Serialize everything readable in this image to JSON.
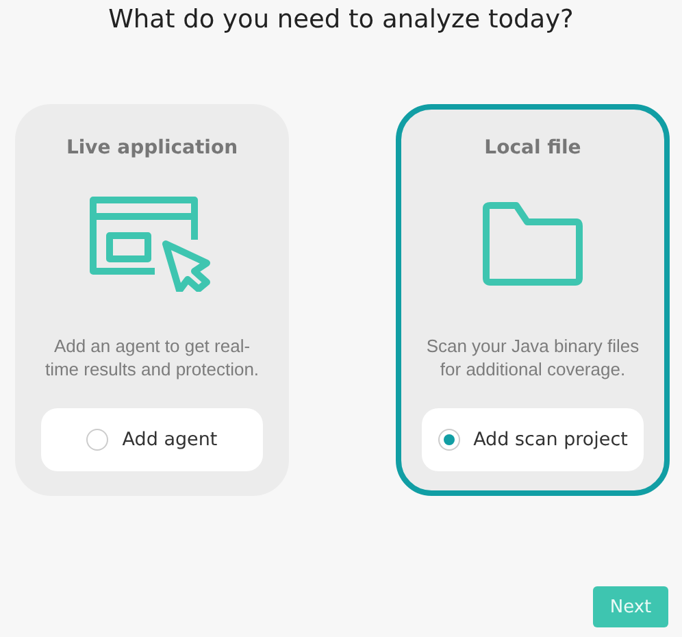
{
  "heading": "What do you need to analyze today?",
  "options": [
    {
      "title": "Live application",
      "kind": "window",
      "description": "Add an agent to get real-time results and protection.",
      "button": "Add agent",
      "selected": false
    },
    {
      "title": "Local file",
      "kind": "folder",
      "description": "Scan your Java binary files for additional coverage.",
      "button": "Add scan project",
      "selected": true
    }
  ],
  "next_button": "Next"
}
